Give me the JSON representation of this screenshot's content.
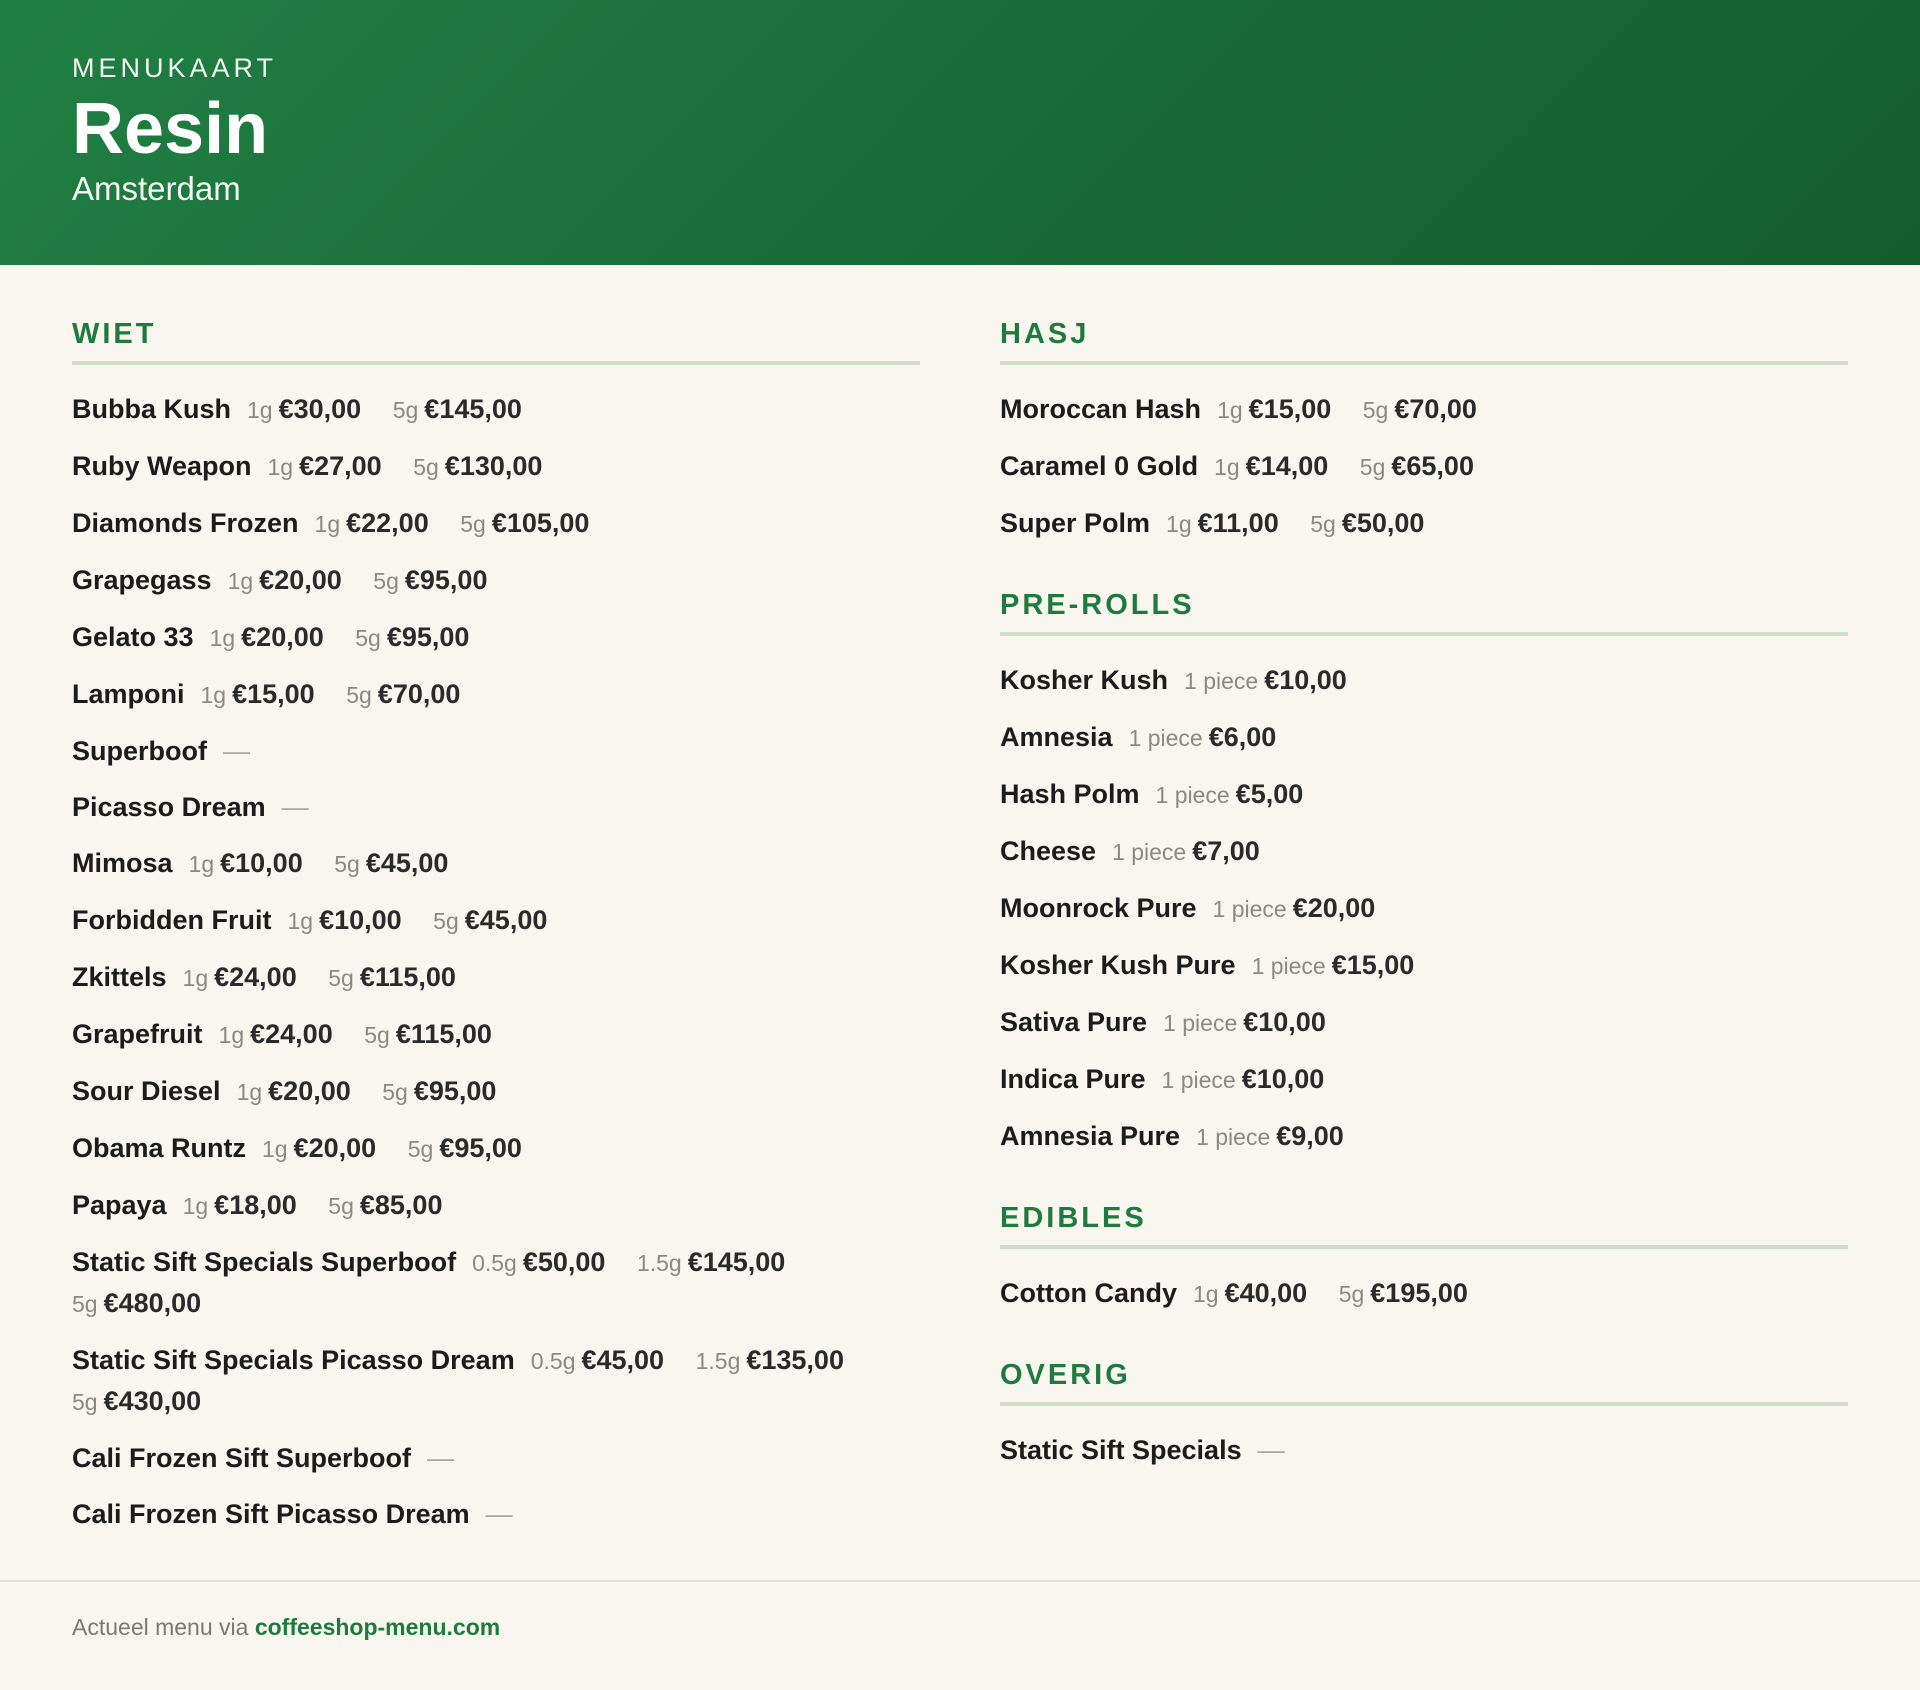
{
  "header": {
    "kicker": "MENUKAART",
    "title": "Resin",
    "subtitle": "Amsterdam"
  },
  "columns": [
    [
      {
        "title": "WIET",
        "items": [
          {
            "name": "Bubba Kush",
            "prices": [
              [
                "1g",
                "€30,00"
              ],
              [
                "5g",
                "€145,00"
              ]
            ]
          },
          {
            "name": "Ruby Weapon",
            "prices": [
              [
                "1g",
                "€27,00"
              ],
              [
                "5g",
                "€130,00"
              ]
            ]
          },
          {
            "name": "Diamonds Frozen",
            "prices": [
              [
                "1g",
                "€22,00"
              ],
              [
                "5g",
                "€105,00"
              ]
            ]
          },
          {
            "name": "Grapegass",
            "prices": [
              [
                "1g",
                "€20,00"
              ],
              [
                "5g",
                "€95,00"
              ]
            ]
          },
          {
            "name": "Gelato 33",
            "prices": [
              [
                "1g",
                "€20,00"
              ],
              [
                "5g",
                "€95,00"
              ]
            ]
          },
          {
            "name": "Lamponi",
            "prices": [
              [
                "1g",
                "€15,00"
              ],
              [
                "5g",
                "€70,00"
              ]
            ]
          },
          {
            "name": "Superboof",
            "dash": "—"
          },
          {
            "name": "Picasso Dream",
            "dash": "—"
          },
          {
            "name": "Mimosa",
            "prices": [
              [
                "1g",
                "€10,00"
              ],
              [
                "5g",
                "€45,00"
              ]
            ]
          },
          {
            "name": "Forbidden Fruit",
            "prices": [
              [
                "1g",
                "€10,00"
              ],
              [
                "5g",
                "€45,00"
              ]
            ]
          },
          {
            "name": "Zkittels",
            "prices": [
              [
                "1g",
                "€24,00"
              ],
              [
                "5g",
                "€115,00"
              ]
            ]
          },
          {
            "name": "Grapefruit",
            "prices": [
              [
                "1g",
                "€24,00"
              ],
              [
                "5g",
                "€115,00"
              ]
            ]
          },
          {
            "name": "Sour Diesel",
            "prices": [
              [
                "1g",
                "€20,00"
              ],
              [
                "5g",
                "€95,00"
              ]
            ]
          },
          {
            "name": "Obama Runtz",
            "prices": [
              [
                "1g",
                "€20,00"
              ],
              [
                "5g",
                "€95,00"
              ]
            ]
          },
          {
            "name": "Papaya",
            "prices": [
              [
                "1g",
                "€18,00"
              ],
              [
                "5g",
                "€85,00"
              ]
            ]
          },
          {
            "name": "Static Sift Specials Superboof",
            "prices": [
              [
                "0.5g",
                "€50,00"
              ],
              [
                "1.5g",
                "€145,00"
              ],
              [
                "5g",
                "€480,00"
              ]
            ]
          },
          {
            "name": "Static Sift Specials Picasso Dream",
            "prices": [
              [
                "0.5g",
                "€45,00"
              ],
              [
                "1.5g",
                "€135,00"
              ],
              [
                "5g",
                "€430,00"
              ]
            ]
          },
          {
            "name": "Cali Frozen Sift Superboof",
            "dash": "—"
          },
          {
            "name": "Cali Frozen Sift Picasso Dream",
            "dash": "—"
          }
        ]
      }
    ],
    [
      {
        "title": "HASJ",
        "items": [
          {
            "name": "Moroccan Hash",
            "prices": [
              [
                "1g",
                "€15,00"
              ],
              [
                "5g",
                "€70,00"
              ]
            ]
          },
          {
            "name": "Caramel 0 Gold",
            "prices": [
              [
                "1g",
                "€14,00"
              ],
              [
                "5g",
                "€65,00"
              ]
            ]
          },
          {
            "name": "Super Polm",
            "prices": [
              [
                "1g",
                "€11,00"
              ],
              [
                "5g",
                "€50,00"
              ]
            ]
          }
        ]
      },
      {
        "title": "PRE-ROLLS",
        "items": [
          {
            "name": "Kosher Kush",
            "prices": [
              [
                "1 piece",
                "€10,00"
              ]
            ]
          },
          {
            "name": "Amnesia",
            "prices": [
              [
                "1 piece",
                "€6,00"
              ]
            ]
          },
          {
            "name": "Hash Polm",
            "prices": [
              [
                "1 piece",
                "€5,00"
              ]
            ]
          },
          {
            "name": "Cheese",
            "prices": [
              [
                "1 piece",
                "€7,00"
              ]
            ]
          },
          {
            "name": "Moonrock Pure",
            "prices": [
              [
                "1 piece",
                "€20,00"
              ]
            ]
          },
          {
            "name": "Kosher Kush Pure",
            "prices": [
              [
                "1 piece",
                "€15,00"
              ]
            ]
          },
          {
            "name": "Sativa Pure",
            "prices": [
              [
                "1 piece",
                "€10,00"
              ]
            ]
          },
          {
            "name": "Indica Pure",
            "prices": [
              [
                "1 piece",
                "€10,00"
              ]
            ]
          },
          {
            "name": "Amnesia Pure",
            "prices": [
              [
                "1 piece",
                "€9,00"
              ]
            ]
          }
        ]
      },
      {
        "title": "EDIBLES",
        "items": [
          {
            "name": "Cotton Candy",
            "prices": [
              [
                "1g",
                "€40,00"
              ],
              [
                "5g",
                "€195,00"
              ]
            ]
          }
        ]
      },
      {
        "title": "OVERIG",
        "items": [
          {
            "name": "Static Sift Specials",
            "dash": "—"
          }
        ]
      }
    ]
  ],
  "footer": {
    "text": "Actueel menu via ",
    "link": "coffeeshop-menu.com"
  },
  "colors": {
    "brand": "#1f7a3e",
    "background": "#f8f6ee",
    "rule": "#cfdcc8"
  }
}
